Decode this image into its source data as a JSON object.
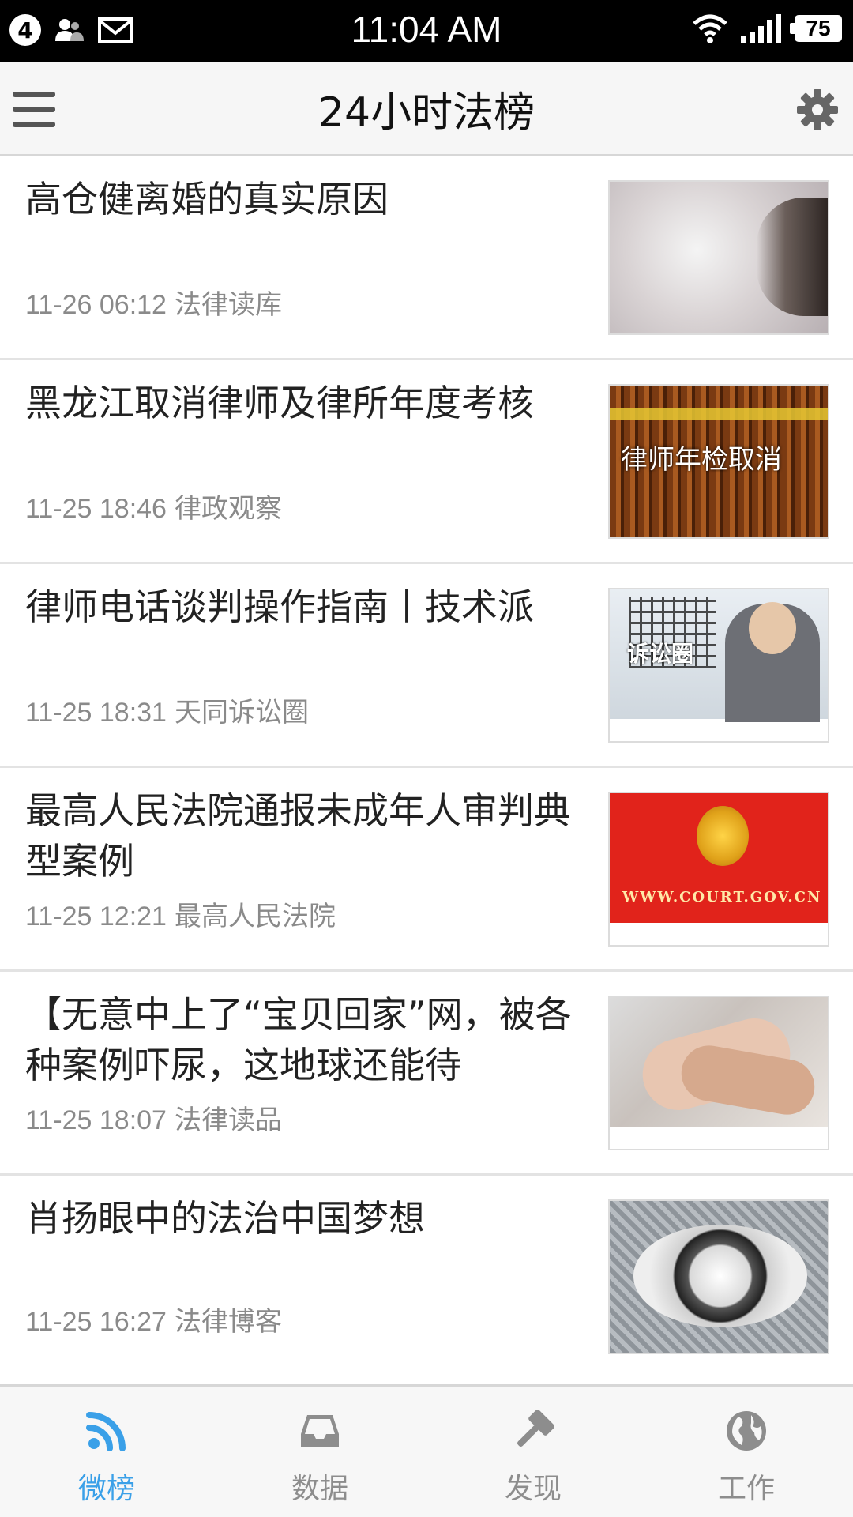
{
  "status_bar": {
    "notification_count": "4",
    "time": "11:04 AM",
    "battery": "75",
    "icons": [
      "contacts-icon",
      "mail-icon",
      "wifi-icon",
      "signal-icon",
      "battery-icon"
    ]
  },
  "header": {
    "title": "24小时法榜",
    "menu_icon": "hamburger-menu-icon",
    "settings_icon": "gear-icon"
  },
  "feed": {
    "items": [
      {
        "title": "高仓健离婚的真实原因",
        "date": "11-26 06:12",
        "source": "法律读库"
      },
      {
        "title": "黑龙江取消律师及律所年度考核",
        "date": "11-25 18:46",
        "source": "律政观察",
        "thumb_caption": "律师年检取消"
      },
      {
        "title": "律师电话谈判操作指南丨技术派",
        "date": "11-25 18:31",
        "source": "天同诉讼圈",
        "thumb_caption": "诉讼圈"
      },
      {
        "title": "最高人民法院通报未成年人审判典型案例",
        "date": "11-25 12:21",
        "source": "最高人民法院",
        "thumb_caption": "WWW.COURT.GOV.CN"
      },
      {
        "title": "【无意中上了“宝贝回家”网，被各种案例吓尿，这地球还能待",
        "date": "11-25 18:07",
        "source": "法律读品"
      },
      {
        "title": "肖扬眼中的法治中国梦想",
        "date": "11-25 16:27",
        "source": "法律博客"
      }
    ]
  },
  "bottom_nav": {
    "active_color": "#3aa0e8",
    "inactive_color": "#8d8d8d",
    "tabs": [
      {
        "label": "微榜",
        "icon": "rss-feed-icon",
        "active": true
      },
      {
        "label": "数据",
        "icon": "inbox-tray-icon",
        "active": false
      },
      {
        "label": "发现",
        "icon": "gavel-icon",
        "active": false
      },
      {
        "label": "工作",
        "icon": "globe-icon",
        "active": false
      }
    ]
  }
}
